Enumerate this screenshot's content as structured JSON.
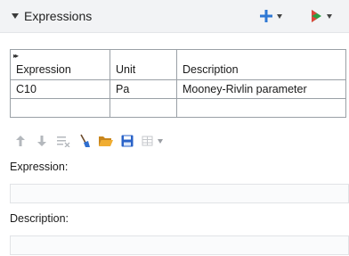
{
  "section": {
    "title": "Expressions"
  },
  "table": {
    "columns": [
      "Expression",
      "Unit",
      "Description"
    ],
    "rows": [
      {
        "expression": "C10",
        "unit": "Pa",
        "description": "Mooney-Rivlin parameter"
      },
      {
        "expression": "",
        "unit": "",
        "description": ""
      }
    ]
  },
  "toolbar": {
    "icons": [
      "arrow-up-icon",
      "arrow-down-icon",
      "delete-rows-icon",
      "clear-brush-icon",
      "open-folder-icon",
      "save-icon",
      "table-settings-icon"
    ]
  },
  "fields": {
    "expression_label": "Expression:",
    "expression_value": "",
    "description_label": "Description:",
    "description_value": ""
  },
  "colors": {
    "header_bg": "#f2f3f5",
    "plus_blue": "#2f78d4",
    "eval_green": "#2e9e44",
    "eval_red": "#e0453a",
    "folder_orange": "#e8a02a",
    "save_blue": "#2a63c8"
  }
}
